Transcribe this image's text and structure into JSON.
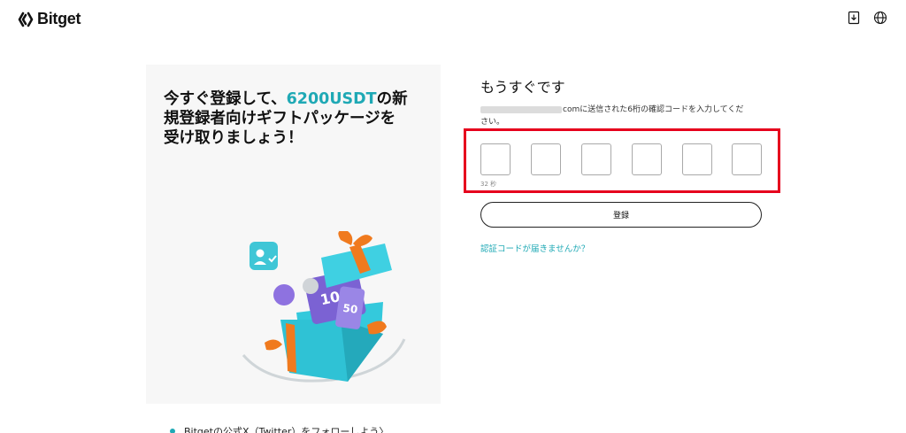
{
  "header": {
    "brand": "Bitget",
    "icons": [
      "download-icon",
      "globe-icon"
    ]
  },
  "promo": {
    "title_line1": "今すぐ登録して、",
    "title_highlight": "6200USDT",
    "title_line1_end": "の新",
    "title_line2": "規登録者向けギフトパッケージを",
    "title_line3": "受け取りましょう！",
    "gift_labels": [
      "100",
      "50"
    ],
    "social_text": "Bitgetの公式X（Twitter）をフォローしよう〉"
  },
  "verify": {
    "title": "もうすぐです",
    "description_line1": "comに送信された6桁の確認コードを入力してくだ",
    "description_line2": "さい。",
    "timer": "32 秒",
    "register_label": "登録",
    "resend_link": "認証コードが届きませんか？"
  },
  "colors": {
    "accent": "#1fa9b5",
    "highlight_border": "#e6001d"
  }
}
